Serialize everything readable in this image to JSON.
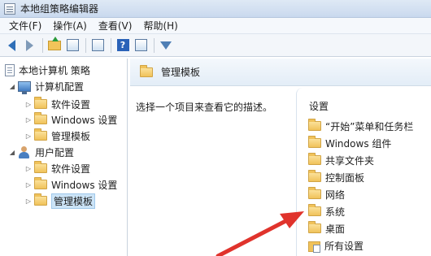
{
  "window": {
    "title": "本地组策略编辑器"
  },
  "menu": [
    "文件(F)",
    "操作(A)",
    "查看(V)",
    "帮助(H)"
  ],
  "toolbar": {
    "icons": [
      "back-arrow-icon",
      "forward-arrow-icon",
      "folder-up-icon",
      "show-hide-tree-icon",
      "export-list-icon",
      "help-icon",
      "properties-icon",
      "filter-icon"
    ]
  },
  "tree": {
    "root": "本地计算机 策略",
    "computer_config": "计算机配置",
    "computer_children": [
      "软件设置",
      "Windows 设置",
      "管理模板"
    ],
    "user_config": "用户配置",
    "user_children": [
      "软件设置",
      "Windows 设置",
      "管理模板"
    ],
    "selected": "管理模板"
  },
  "main": {
    "header_title": "管理模板",
    "description": "选择一个项目来查看它的描述。",
    "settings_header": "设置",
    "items": [
      "“开始”菜单和任务栏",
      "Windows 组件",
      "共享文件夹",
      "控制面板",
      "网络",
      "系统",
      "桌面",
      "所有设置"
    ]
  },
  "colors": {
    "annotation_arrow": "#e0332c",
    "selection": "#cce4f7"
  }
}
